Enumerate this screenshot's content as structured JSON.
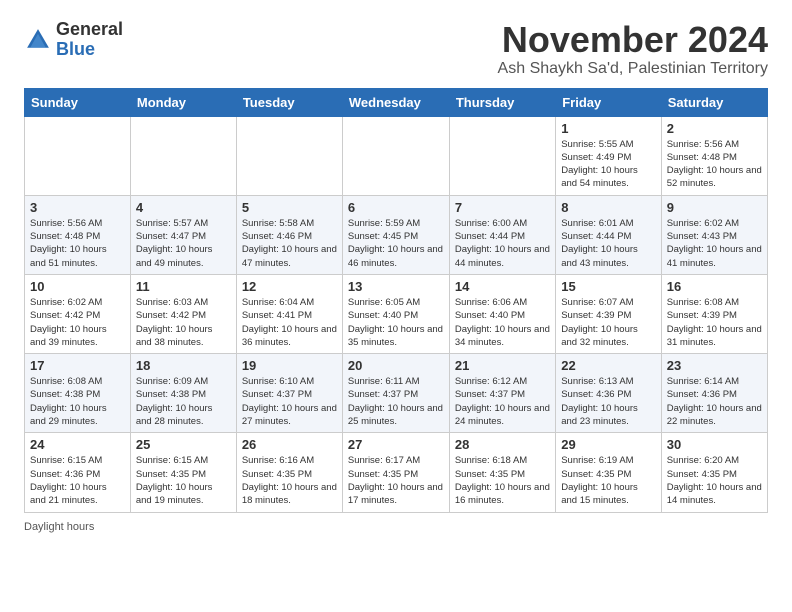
{
  "logo": {
    "general": "General",
    "blue": "Blue"
  },
  "header": {
    "title": "November 2024",
    "subtitle": "Ash Shaykh Sa'd, Palestinian Territory"
  },
  "weekdays": [
    "Sunday",
    "Monday",
    "Tuesday",
    "Wednesday",
    "Thursday",
    "Friday",
    "Saturday"
  ],
  "weeks": [
    [
      {
        "day": "",
        "info": ""
      },
      {
        "day": "",
        "info": ""
      },
      {
        "day": "",
        "info": ""
      },
      {
        "day": "",
        "info": ""
      },
      {
        "day": "",
        "info": ""
      },
      {
        "day": "1",
        "info": "Sunrise: 5:55 AM\nSunset: 4:49 PM\nDaylight: 10 hours\nand 54 minutes."
      },
      {
        "day": "2",
        "info": "Sunrise: 5:56 AM\nSunset: 4:48 PM\nDaylight: 10 hours\nand 52 minutes."
      }
    ],
    [
      {
        "day": "3",
        "info": "Sunrise: 5:56 AM\nSunset: 4:48 PM\nDaylight: 10 hours\nand 51 minutes."
      },
      {
        "day": "4",
        "info": "Sunrise: 5:57 AM\nSunset: 4:47 PM\nDaylight: 10 hours\nand 49 minutes."
      },
      {
        "day": "5",
        "info": "Sunrise: 5:58 AM\nSunset: 4:46 PM\nDaylight: 10 hours\nand 47 minutes."
      },
      {
        "day": "6",
        "info": "Sunrise: 5:59 AM\nSunset: 4:45 PM\nDaylight: 10 hours\nand 46 minutes."
      },
      {
        "day": "7",
        "info": "Sunrise: 6:00 AM\nSunset: 4:44 PM\nDaylight: 10 hours\nand 44 minutes."
      },
      {
        "day": "8",
        "info": "Sunrise: 6:01 AM\nSunset: 4:44 PM\nDaylight: 10 hours\nand 43 minutes."
      },
      {
        "day": "9",
        "info": "Sunrise: 6:02 AM\nSunset: 4:43 PM\nDaylight: 10 hours\nand 41 minutes."
      }
    ],
    [
      {
        "day": "10",
        "info": "Sunrise: 6:02 AM\nSunset: 4:42 PM\nDaylight: 10 hours\nand 39 minutes."
      },
      {
        "day": "11",
        "info": "Sunrise: 6:03 AM\nSunset: 4:42 PM\nDaylight: 10 hours\nand 38 minutes."
      },
      {
        "day": "12",
        "info": "Sunrise: 6:04 AM\nSunset: 4:41 PM\nDaylight: 10 hours\nand 36 minutes."
      },
      {
        "day": "13",
        "info": "Sunrise: 6:05 AM\nSunset: 4:40 PM\nDaylight: 10 hours\nand 35 minutes."
      },
      {
        "day": "14",
        "info": "Sunrise: 6:06 AM\nSunset: 4:40 PM\nDaylight: 10 hours\nand 34 minutes."
      },
      {
        "day": "15",
        "info": "Sunrise: 6:07 AM\nSunset: 4:39 PM\nDaylight: 10 hours\nand 32 minutes."
      },
      {
        "day": "16",
        "info": "Sunrise: 6:08 AM\nSunset: 4:39 PM\nDaylight: 10 hours\nand 31 minutes."
      }
    ],
    [
      {
        "day": "17",
        "info": "Sunrise: 6:08 AM\nSunset: 4:38 PM\nDaylight: 10 hours\nand 29 minutes."
      },
      {
        "day": "18",
        "info": "Sunrise: 6:09 AM\nSunset: 4:38 PM\nDaylight: 10 hours\nand 28 minutes."
      },
      {
        "day": "19",
        "info": "Sunrise: 6:10 AM\nSunset: 4:37 PM\nDaylight: 10 hours\nand 27 minutes."
      },
      {
        "day": "20",
        "info": "Sunrise: 6:11 AM\nSunset: 4:37 PM\nDaylight: 10 hours\nand 25 minutes."
      },
      {
        "day": "21",
        "info": "Sunrise: 6:12 AM\nSunset: 4:37 PM\nDaylight: 10 hours\nand 24 minutes."
      },
      {
        "day": "22",
        "info": "Sunrise: 6:13 AM\nSunset: 4:36 PM\nDaylight: 10 hours\nand 23 minutes."
      },
      {
        "day": "23",
        "info": "Sunrise: 6:14 AM\nSunset: 4:36 PM\nDaylight: 10 hours\nand 22 minutes."
      }
    ],
    [
      {
        "day": "24",
        "info": "Sunrise: 6:15 AM\nSunset: 4:36 PM\nDaylight: 10 hours\nand 21 minutes."
      },
      {
        "day": "25",
        "info": "Sunrise: 6:15 AM\nSunset: 4:35 PM\nDaylight: 10 hours\nand 19 minutes."
      },
      {
        "day": "26",
        "info": "Sunrise: 6:16 AM\nSunset: 4:35 PM\nDaylight: 10 hours\nand 18 minutes."
      },
      {
        "day": "27",
        "info": "Sunrise: 6:17 AM\nSunset: 4:35 PM\nDaylight: 10 hours\nand 17 minutes."
      },
      {
        "day": "28",
        "info": "Sunrise: 6:18 AM\nSunset: 4:35 PM\nDaylight: 10 hours\nand 16 minutes."
      },
      {
        "day": "29",
        "info": "Sunrise: 6:19 AM\nSunset: 4:35 PM\nDaylight: 10 hours\nand 15 minutes."
      },
      {
        "day": "30",
        "info": "Sunrise: 6:20 AM\nSunset: 4:35 PM\nDaylight: 10 hours\nand 14 minutes."
      }
    ]
  ],
  "footer": {
    "daylight_label": "Daylight hours"
  }
}
